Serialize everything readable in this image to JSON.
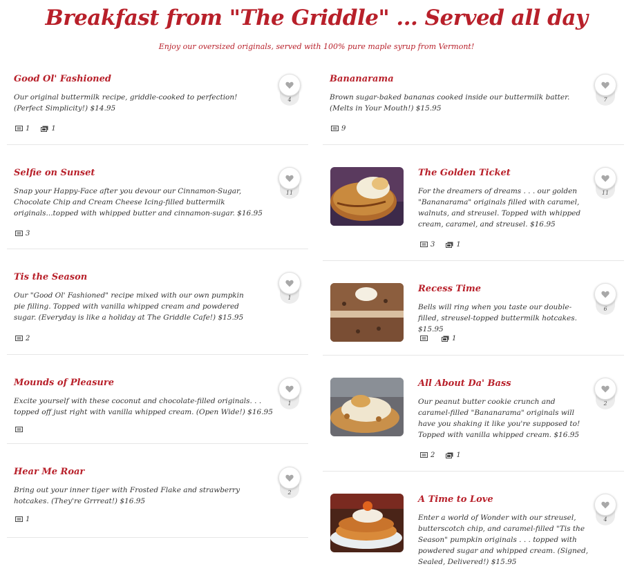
{
  "header": {
    "title": "Breakfast from \"The Griddle\" ... Served all day",
    "subtitle": "Enjoy our oversized originals, served with 100% pure maple syrup from Vermont!"
  },
  "colors": {
    "accent": "#b8202a",
    "text": "#333333",
    "divider": "#e6e6e6"
  },
  "left_items": [
    {
      "name": "Good Ol' Fashioned",
      "desc": "Our original buttermilk recipe, griddle-cooked to perfection! (Perfect Simplicity!) $14.95",
      "likes": "4",
      "comments": "1",
      "photos": "1"
    },
    {
      "name": "Selfie on Sunset",
      "desc": "Snap your Happy-Face after you devour our Cinnamon-Sugar, Chocolate Chip and Cream Cheese Icing-filled buttermilk originals...topped with whipped butter and cinnamon-sugar. $16.95",
      "likes": "11",
      "comments": "3"
    },
    {
      "name": "Tis the Season",
      "desc": "Our \"Good Ol' Fashioned\" recipe mixed with our own pumpkin pie filling. Topped with vanilla whipped cream and powdered sugar. (Everyday is like a holiday at The Griddle Cafe!) $15.95",
      "likes": "1",
      "comments": "2"
    },
    {
      "name": "Mounds of Pleasure",
      "desc": "Excite yourself with these coconut and chocolate-filled originals. . . topped off just right with vanilla whipped cream. (Open Wide!) $16.95",
      "likes": "1"
    },
    {
      "name": "Hear Me Roar",
      "desc": "Bring out your inner tiger with Frosted Flake and strawberry hotcakes. (They're Grrreat!) $16.95",
      "likes": "2",
      "comments": "1"
    }
  ],
  "right_items": [
    {
      "name": "Bananarama",
      "desc": "Brown sugar-baked bananas cooked inside our buttermilk batter. (Melts in Your Mouth!) $15.95",
      "likes": "7",
      "comments": "9"
    },
    {
      "name": "The Golden Ticket",
      "desc": "For the dreamers of dreams . . . our golden \"Bananarama\" originals filled with caramel, walnuts, and streusel. Topped with whipped cream, caramel, and streusel. $16.95",
      "likes": "11",
      "comments": "3",
      "photos": "1"
    },
    {
      "name": "Recess Time",
      "desc": "Bells will ring when you taste our double-filled, streusel-topped buttermilk hotcakes. $15.95",
      "likes": "6",
      "photos": "1"
    },
    {
      "name": "All About Da' Bass",
      "desc": "Our peanut butter cookie crunch and caramel-filled \"Bananarama\" originals will have you shaking it like you're supposed to! Topped with vanilla whipped cream. $16.95",
      "likes": "2",
      "comments": "2",
      "photos": "1"
    },
    {
      "name": "A Time to Love",
      "desc": "Enter a world of Wonder with our streusel, butterscotch chip, and caramel-filled \"Tis the Season\" pumpkin originals . . . topped with powdered sugar and whipped cream. (Signed, Sealed, Delivered!) $15.95",
      "likes": "4"
    }
  ],
  "icons": {
    "like": "heart-icon",
    "comment": "comment-icon",
    "photo": "photo-icon"
  }
}
